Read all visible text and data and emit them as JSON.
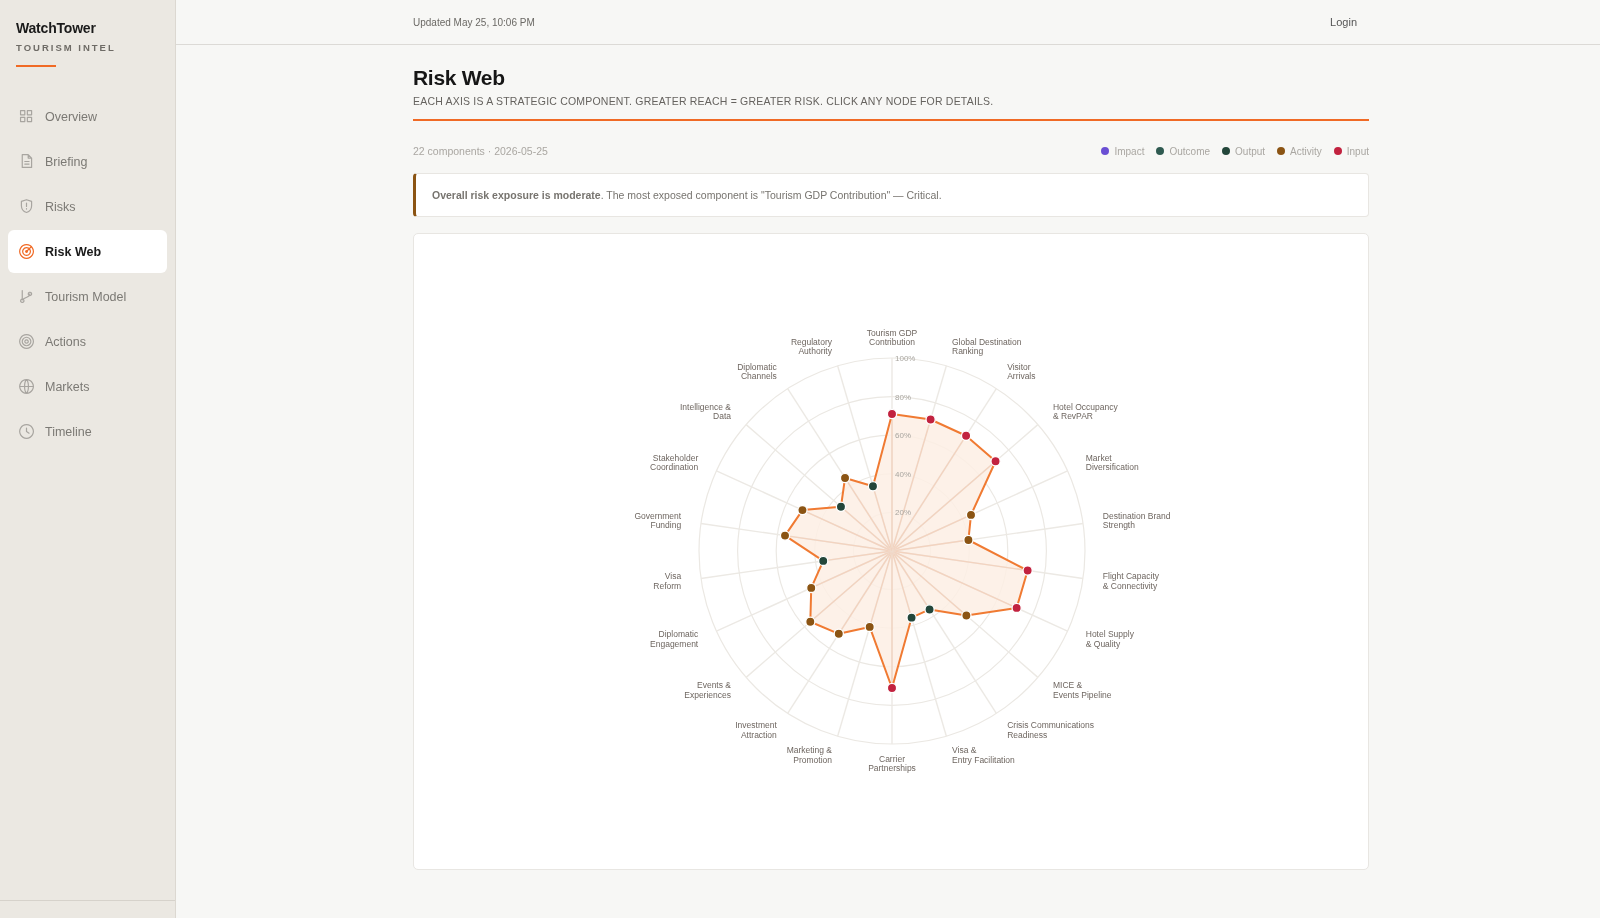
{
  "sidebar": {
    "brand": "WatchTower",
    "tagline": "TOURISM INTEL",
    "items": [
      {
        "label": "Overview",
        "kind": "grid",
        "selected": false
      },
      {
        "label": "Briefing",
        "kind": "doc",
        "selected": false
      },
      {
        "label": "Risks",
        "kind": "shield",
        "selected": false
      },
      {
        "label": "Risk Web",
        "kind": "radar",
        "selected": true
      },
      {
        "label": "Tourism Model",
        "kind": "branch",
        "selected": false
      },
      {
        "label": "Actions",
        "kind": "target",
        "selected": false
      },
      {
        "label": "Markets",
        "kind": "globe",
        "selected": false
      },
      {
        "label": "Timeline",
        "kind": "clock",
        "selected": false
      }
    ]
  },
  "topbar": {
    "updated": "Updated May 25, 10:06 PM",
    "login": "Login"
  },
  "page": {
    "title": "Risk Web",
    "subtitle": "EACH AXIS IS A STRATEGIC COMPONENT. GREATER REACH = GREATER RISK. CLICK ANY NODE FOR DETAILS."
  },
  "meta": "22 components · 2026-05-25",
  "legend": [
    {
      "label": "Impact",
      "kind": "impact",
      "color": "#6a4fd3"
    },
    {
      "label": "Outcome",
      "kind": "outcome",
      "color": "#2f5a50"
    },
    {
      "label": "Output",
      "kind": "output",
      "color": "#23463a"
    },
    {
      "label": "Activity",
      "kind": "activity",
      "color": "#8b5413"
    },
    {
      "label": "Input",
      "kind": "input",
      "color": "#c2223f"
    }
  ],
  "alert": "**Overall risk exposure is moderate**. The most exposed component is \"Tourism GDP Contribution\" — Critical.",
  "radar": {
    "ring_labels": [
      "100%",
      "80%",
      "60%",
      "40%",
      "20%"
    ],
    "right_axes": [
      {
        "label": "Tourism GDP\nContribution",
        "level": 0.71,
        "kind": "input"
      },
      {
        "label": "Global Destination\nRanking",
        "level": 0.71,
        "kind": "input"
      },
      {
        "label": "Visitor\nArrivals",
        "level": 0.71,
        "kind": "input"
      },
      {
        "label": "Hotel Occupancy\n& RevPAR",
        "level": 0.71,
        "kind": "input"
      },
      {
        "label": "Market\nDiversification",
        "level": 0.45,
        "kind": "activity"
      },
      {
        "label": "Destination Brand\nStrength",
        "level": 0.4,
        "kind": "activity"
      },
      {
        "label": "Flight Capacity\n& Connectivity",
        "level": 0.71,
        "kind": "input"
      },
      {
        "label": "Hotel Supply\n& Quality",
        "level": 0.71,
        "kind": "input"
      },
      {
        "label": "MICE &\nEvents Pipeline",
        "level": 0.51,
        "kind": "activity"
      },
      {
        "label": "Crisis Communications\nReadiness",
        "level": 0.36,
        "kind": "output"
      },
      {
        "label": "Visa &\nEntry Facilitation",
        "level": 0.36,
        "kind": "output"
      },
      {
        "label": "Carrier\nPartnerships",
        "level": 0.71,
        "kind": "input"
      }
    ],
    "left_axes": [
      {
        "label": "Regulatory\nAuthority",
        "level": 0.35,
        "kind": "output"
      },
      {
        "label": "Diplomatic\nChannels",
        "level": 0.45,
        "kind": "activity"
      },
      {
        "label": "Intelligence &\nData",
        "level": 0.35,
        "kind": "output"
      },
      {
        "label": "Stakeholder\nCoordination",
        "level": 0.51,
        "kind": "activity"
      },
      {
        "label": "Government\nFunding",
        "level": 0.56,
        "kind": "activity"
      },
      {
        "label": "Visa\nReform",
        "level": 0.36,
        "kind": "output"
      },
      {
        "label": "Diplomatic\nEngagement",
        "level": 0.46,
        "kind": "activity"
      },
      {
        "label": "Events &\nExperiences",
        "level": 0.56,
        "kind": "activity"
      },
      {
        "label": "Investment\nAttraction",
        "level": 0.51,
        "kind": "activity"
      },
      {
        "label": "Marketing &\nPromotion",
        "level": 0.41,
        "kind": "activity"
      }
    ]
  }
}
